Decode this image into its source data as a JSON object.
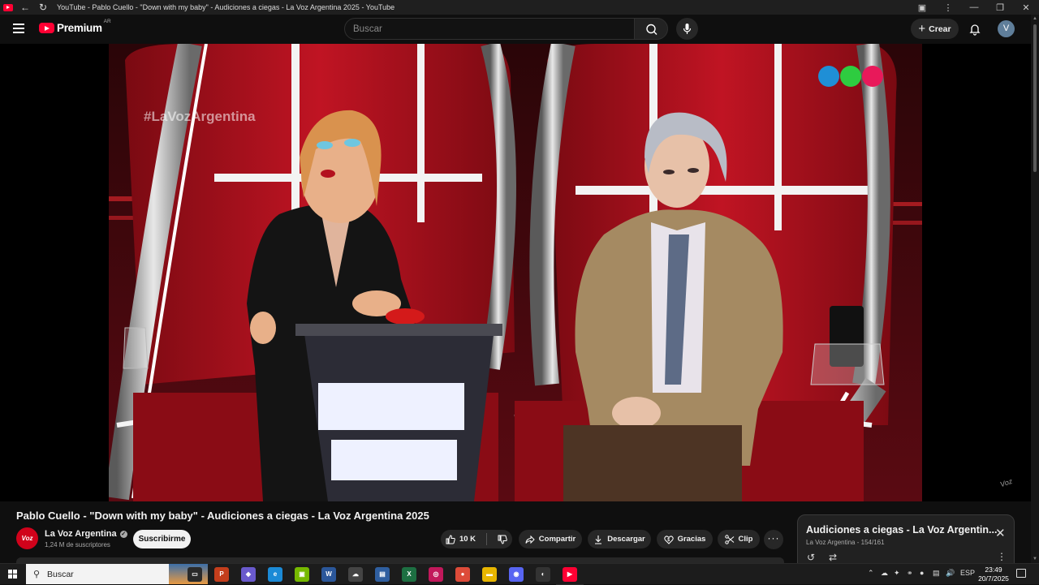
{
  "window": {
    "title": "YouTube - Pablo Cuello - \"Down with my baby\" - Audiciones a ciegas - La Voz Argentina 2025 - YouTube",
    "controls": [
      "minimize-icon",
      "restore-icon",
      "close-icon"
    ]
  },
  "masthead": {
    "logo_text": "Premium",
    "country_code": "AR",
    "search_placeholder": "Buscar",
    "create_label": "Crear",
    "avatar_letter": "V"
  },
  "video": {
    "overlay_hashtag": "#LaVozArgentina",
    "broadcaster_logo_colors": [
      "#1f8fd6",
      "#2ecc40",
      "#e8195a"
    ],
    "title": "Pablo Cuello - \"Down with my baby\" - Audiciones a ciegas - La Voz Argentina 2025"
  },
  "channel": {
    "avatar_text": "Voz",
    "name": "La Voz Argentina",
    "subscribers": "1,24 M de suscriptores",
    "subscribe_label": "Suscribirme"
  },
  "actions": {
    "likes": "10 K",
    "share": "Compartir",
    "download": "Descargar",
    "thanks": "Gracias",
    "clip": "Clip"
  },
  "playlist": {
    "title": "Audiciones a ciegas - La Voz Argentin...",
    "channel": "La Voz Argentina",
    "position": "154/161"
  },
  "taskbar": {
    "search_label": "Buscar",
    "language": "ESP",
    "time": "23:49",
    "date": "20/7/2025",
    "apps": [
      {
        "name": "task-view",
        "color": "#2a2a2a",
        "glyph": "▭"
      },
      {
        "name": "powerpoint",
        "color": "#c43e1c",
        "glyph": "P"
      },
      {
        "name": "copilot",
        "color": "#6a5acd",
        "glyph": "◆"
      },
      {
        "name": "edge",
        "color": "#1b8ad6",
        "glyph": "e"
      },
      {
        "name": "nvidia",
        "color": "#76b900",
        "glyph": "▣"
      },
      {
        "name": "word",
        "color": "#2b579a",
        "glyph": "W"
      },
      {
        "name": "cloud-app",
        "color": "#444",
        "glyph": "☁"
      },
      {
        "name": "storage-app",
        "color": "#2f5fa0",
        "glyph": "▤"
      },
      {
        "name": "excel",
        "color": "#1d6f42",
        "glyph": "X"
      },
      {
        "name": "media-app",
        "color": "#c2185b",
        "glyph": "◎"
      },
      {
        "name": "chrome",
        "color": "#dd4b39",
        "glyph": "●"
      },
      {
        "name": "file-explorer",
        "color": "#e8b600",
        "glyph": "▬"
      },
      {
        "name": "discord",
        "color": "#5865f2",
        "glyph": "◉"
      },
      {
        "name": "steam-app",
        "color": "#333",
        "glyph": "◐"
      },
      {
        "name": "youtube",
        "color": "#ff0033",
        "glyph": "▶"
      }
    ]
  }
}
